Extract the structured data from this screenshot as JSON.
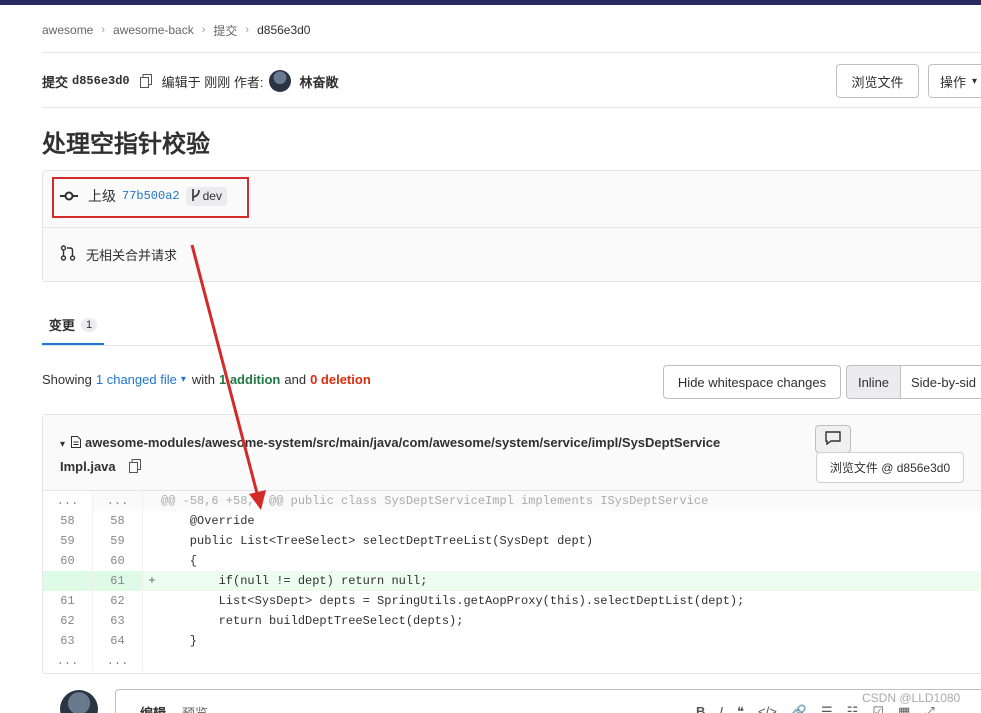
{
  "breadcrumb": [
    "awesome",
    "awesome-back",
    "提交",
    "d856e3d0"
  ],
  "commit": {
    "label": "提交",
    "sha": "d856e3d0",
    "edited_text": "编辑于 刚刚 作者:",
    "author": "林奋敞"
  },
  "buttons": {
    "browse_files": "浏览文件",
    "actions": "操作"
  },
  "title": "处理空指针校验",
  "parent": {
    "label": "上级",
    "sha": "77b500a2",
    "branch": "dev"
  },
  "merge_request_text": "无相关合并请求",
  "tabs": [
    {
      "label": "变更",
      "count": "1"
    }
  ],
  "summary": {
    "showing": "Showing",
    "changed": "1 changed file",
    "with": "with",
    "additions": "1 addition",
    "and": "and",
    "deletions": "0 deletion"
  },
  "diff_controls": {
    "hide_whitespace": "Hide whitespace changes",
    "inline": "Inline",
    "side_by_side": "Side-by-sid"
  },
  "file": {
    "path_line1": "awesome-modules/awesome-system/src/main/java/com/awesome/system/service/impl/SysDeptService",
    "path_line2": "Impl.java",
    "view_file": "浏览文件 @ d856e3d0"
  },
  "diff_lines": [
    {
      "old": "...",
      "new": "...",
      "marker": "",
      "type": "meta",
      "code": "@@ -58,6 +58,7 @@ public class SysDeptServiceImpl implements ISysDeptService"
    },
    {
      "old": "58",
      "new": "58",
      "marker": "",
      "type": "ctx",
      "code": "    @Override"
    },
    {
      "old": "59",
      "new": "59",
      "marker": "",
      "type": "ctx",
      "code": "    public List<TreeSelect> selectDeptTreeList(SysDept dept)"
    },
    {
      "old": "60",
      "new": "60",
      "marker": "",
      "type": "ctx",
      "code": "    {"
    },
    {
      "old": "",
      "new": "61",
      "marker": "+",
      "type": "add",
      "code": "        if(null != dept) return null;"
    },
    {
      "old": "61",
      "new": "62",
      "marker": "",
      "type": "ctx",
      "code": "        List<SysDept> depts = SpringUtils.getAopProxy(this).selectDeptList(dept);"
    },
    {
      "old": "62",
      "new": "63",
      "marker": "",
      "type": "ctx",
      "code": "        return buildDeptTreeSelect(depts);"
    },
    {
      "old": "63",
      "new": "64",
      "marker": "",
      "type": "ctx",
      "code": "    }"
    },
    {
      "old": "...",
      "new": "...",
      "marker": "",
      "type": "ctx",
      "code": ""
    }
  ],
  "editor": {
    "tab_write": "编辑",
    "tab_preview": "预览",
    "tools": [
      "B",
      "I",
      "❝",
      "</>",
      "🔗",
      "☰",
      "☷",
      "☑",
      "▦",
      "⤢"
    ]
  },
  "watermark": "CSDN @LLD1080",
  "colors": {
    "accent": "#1f75cb",
    "addition": "#217645",
    "deletion": "#dd2b0e",
    "annotation": "#d42a2a"
  }
}
